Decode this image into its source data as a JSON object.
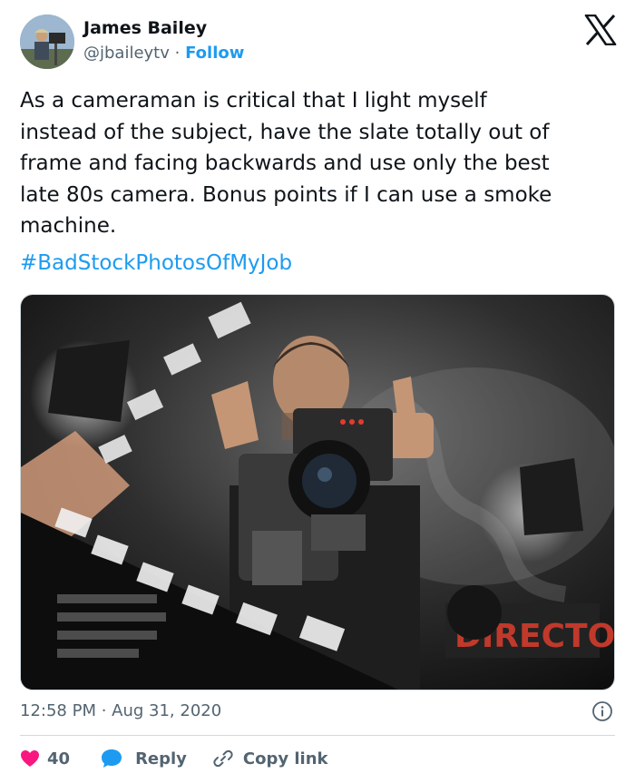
{
  "author": {
    "name": "James Bailey",
    "handle": "@jbaileytv",
    "separator": "·",
    "follow_label": "Follow"
  },
  "tweet": {
    "text": "As a cameraman is critical that I light myself\ninstead of the subject, have the slate totally out of\nframe and facing backwards and use only the best\nlate 80s camera. Bonus points if I can use a smoke\nmachine.",
    "hashtag": "#BadStockPhotosOfMyJob",
    "photo_sign_text": "DIRECTOR",
    "timestamp": "12:58 PM · Aug 31, 2020"
  },
  "actions": {
    "likes": "40",
    "reply_label": "Reply",
    "copy_label": "Copy link"
  },
  "colors": {
    "accent": "#1d9bf0",
    "like": "#f91880",
    "text": "#0f1419",
    "muted": "#536471",
    "divider": "#cfd9de"
  },
  "icons": [
    "x-logo-icon",
    "info-icon",
    "heart-icon",
    "reply-bubble-icon",
    "link-icon"
  ]
}
